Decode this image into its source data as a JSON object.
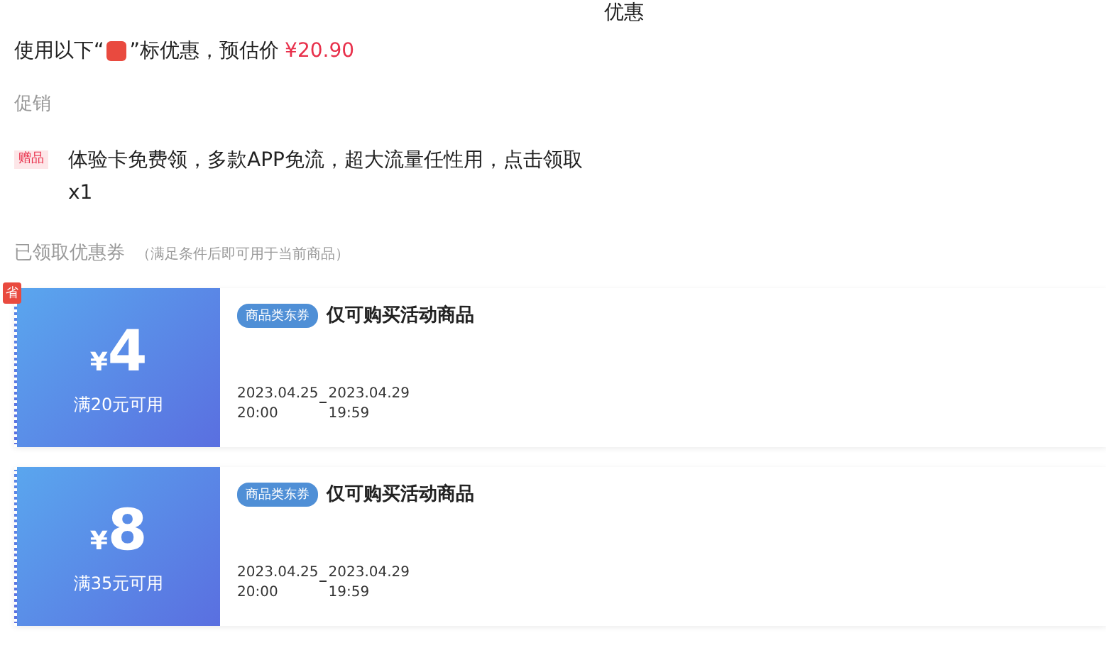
{
  "title": "优惠",
  "estimate": {
    "before": "使用以下“",
    "after": "”标优惠，预估价",
    "price": "¥20.90"
  },
  "promo_heading": "促销",
  "promos": [
    {
      "tag": "赠品",
      "text": "体验卡免费领，多款APP免流，超大流量任性用，点击领取",
      "count": "x1"
    }
  ],
  "coupons_heading": "已领取优惠券",
  "coupons_note": "（满足条件后即可用于当前商品）",
  "coupons": [
    {
      "flag": "省",
      "currency": "¥",
      "amount": "4",
      "condition": "满20元可用",
      "tag": "商品类东券",
      "desc": "仅可购买活动商品",
      "start_date": "2023.04.25",
      "start_time": "20:00",
      "end_date": "2023.04.29",
      "end_time": "19:59"
    },
    {
      "currency": "¥",
      "amount": "8",
      "condition": "满35元可用",
      "tag": "商品类东券",
      "desc": "仅可购买活动商品",
      "start_date": "2023.04.25",
      "start_time": "20:00",
      "end_date": "2023.04.29",
      "end_time": "19:59"
    }
  ]
}
